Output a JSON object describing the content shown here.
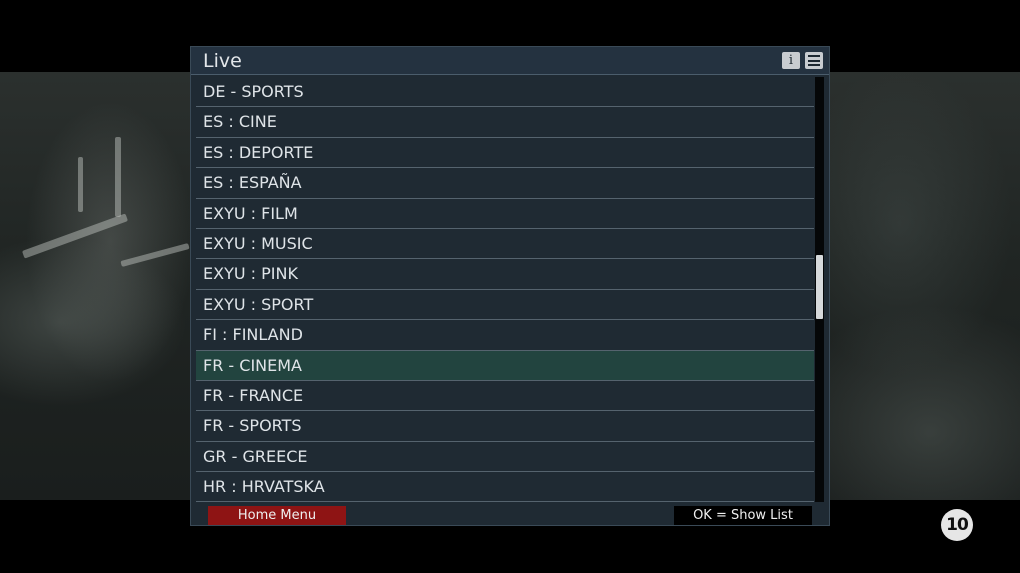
{
  "panel": {
    "title": "Live",
    "info_icon": "i",
    "menu_icon": "hamburger-menu-icon"
  },
  "channels": [
    {
      "label": "DE - SPORTS",
      "selected": false
    },
    {
      "label": "ES : CINE",
      "selected": false
    },
    {
      "label": "ES : DEPORTE",
      "selected": false
    },
    {
      "label": "ES : ESPAÑA",
      "selected": false
    },
    {
      "label": "EXYU : FILM",
      "selected": false
    },
    {
      "label": "EXYU : MUSIC",
      "selected": false
    },
    {
      "label": "EXYU : PINK",
      "selected": false
    },
    {
      "label": "EXYU : SPORT",
      "selected": false
    },
    {
      "label": "FI : FINLAND",
      "selected": false
    },
    {
      "label": "FR - CINEMA",
      "selected": true
    },
    {
      "label": "FR - FRANCE",
      "selected": false
    },
    {
      "label": "FR - SPORTS",
      "selected": false
    },
    {
      "label": "GR - GREECE",
      "selected": false
    },
    {
      "label": "HR : HRVATSKA",
      "selected": false
    }
  ],
  "footer": {
    "home_menu_label": "Home Menu",
    "ok_hint_label": "OK = Show List"
  },
  "overlay": {
    "channel_logo_text": "10"
  },
  "colors": {
    "panel_bg": "#1f2a33",
    "selected_row": "#22443f",
    "home_button": "#8e1414"
  }
}
